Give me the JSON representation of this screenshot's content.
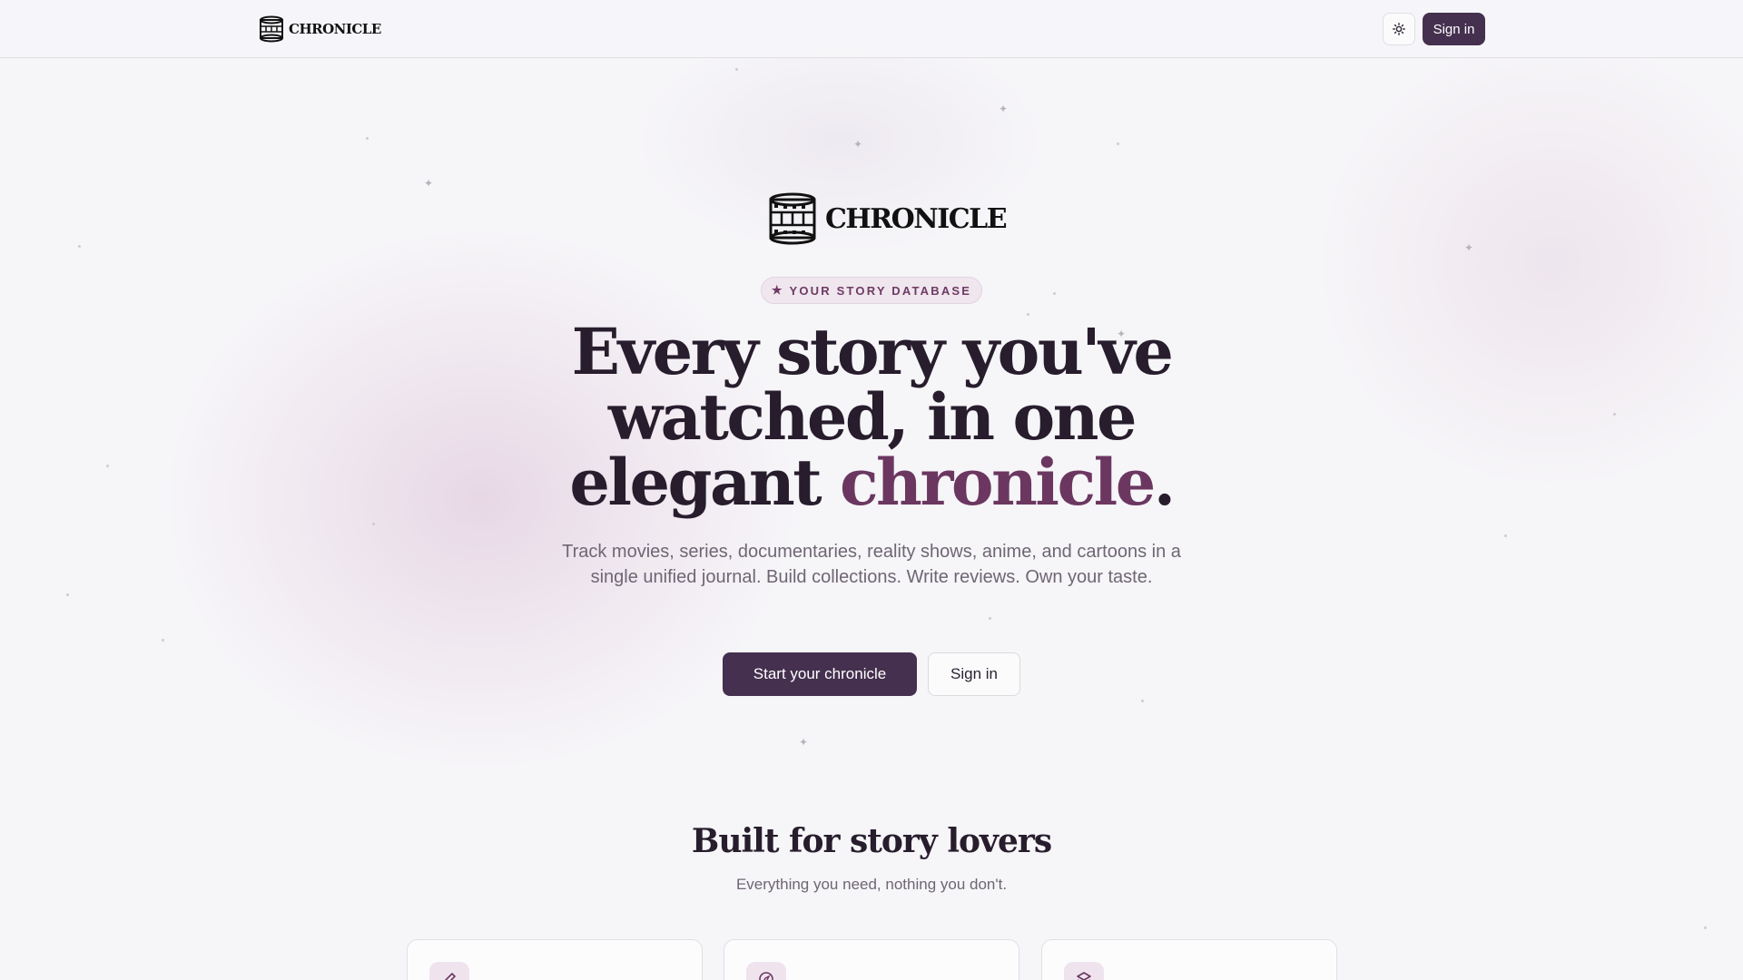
{
  "header": {
    "logo_text": "CHRONICLE",
    "signin_label": "Sign in"
  },
  "hero": {
    "logo_text": "CHRONICLE",
    "badge": "YOUR STORY DATABASE",
    "headline_line1": "Every story you've",
    "headline_line2": "watched, in one",
    "headline_line3_part1": "elegant ",
    "headline_accent": "chronicle",
    "headline_end": ".",
    "subtitle": "Track movies, series, documentaries, reality shows, anime, and cartoons in a single unified journal. Build collections. Write reviews. Own your taste.",
    "cta_primary": "Start your chronicle",
    "cta_secondary": "Sign in"
  },
  "features": {
    "title": "Built for story lovers",
    "subtitle": "Everything you need, nothing you don't.",
    "cards": [
      {
        "icon": "pen-icon"
      },
      {
        "icon": "compass-icon"
      },
      {
        "icon": "layers-icon"
      }
    ]
  },
  "colors": {
    "brand": "#45304f",
    "accent": "#6b3760",
    "background": "#f6f5f8"
  }
}
